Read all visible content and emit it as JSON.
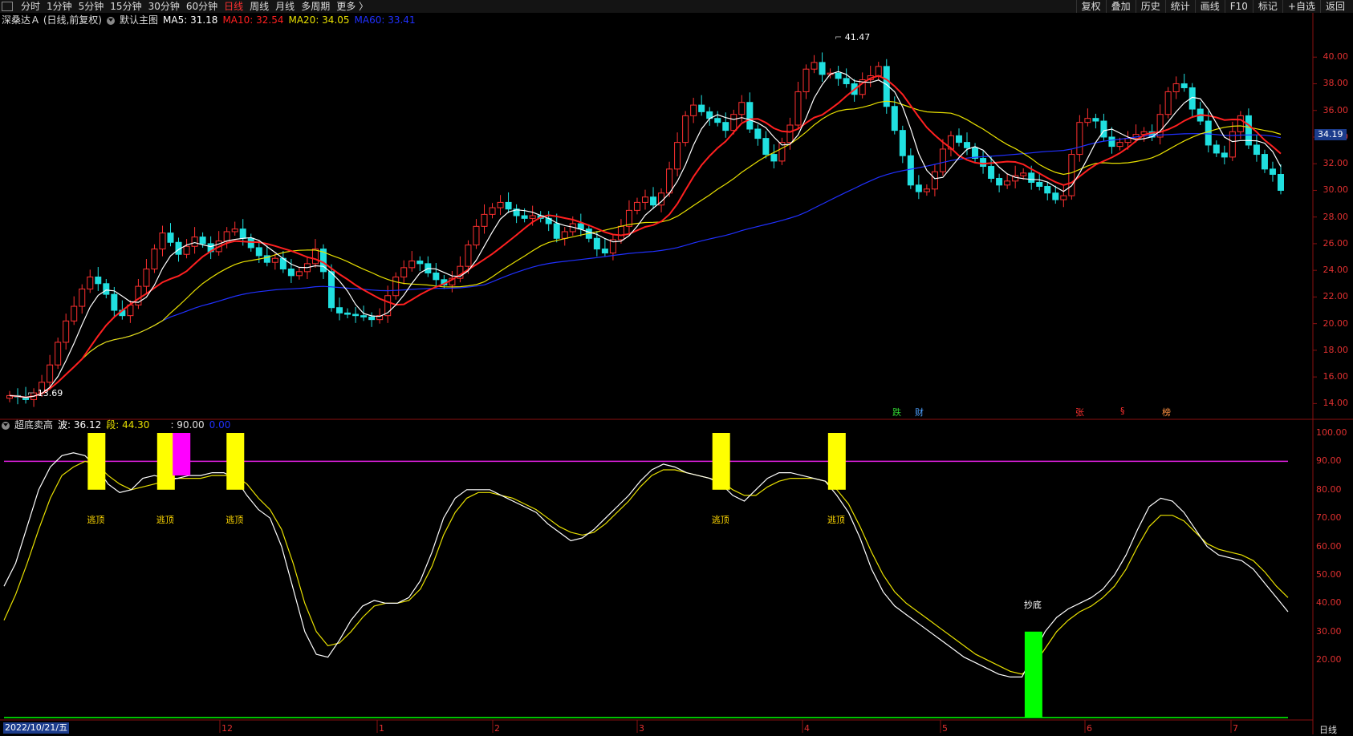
{
  "toolbar": {
    "periods": [
      "分时",
      "1分钟",
      "5分钟",
      "15分钟",
      "30分钟",
      "60分钟",
      "日线",
      "周线",
      "月线",
      "多周期",
      "更多 〉"
    ],
    "active_period": "日线",
    "actions": [
      "复权",
      "叠加",
      "历史",
      "统计",
      "画线",
      "F10",
      "标记",
      "+自选",
      "返回"
    ]
  },
  "main_info": {
    "stock": "深桑达Ａ (日线,前复权)",
    "template": "默认主图",
    "ma5": "MA5: 31.18",
    "ma10": "MA10: 32.54",
    "ma20": "MA20: 34.05",
    "ma60": "MA60: 33.41"
  },
  "ind_info": {
    "name": "超底卖高",
    "bo": "波: 36.12",
    "duan": "段: 44.30",
    "line": ": 90.00",
    "zero": "0.00"
  },
  "price_axis": [
    "40.00",
    "38.00",
    "36.00",
    "34.00",
    "32.00",
    "30.00",
    "28.00",
    "26.00",
    "24.00",
    "22.00",
    "20.00",
    "18.00",
    "16.00",
    "14.00"
  ],
  "ind_axis": [
    "100.00",
    "90.00",
    "80.00",
    "70.00",
    "60.00",
    "50.00",
    "40.00",
    "30.00",
    "20.00"
  ],
  "high_label": "41.47",
  "low_label": "13.69",
  "current_price": "34.19",
  "signals": [
    "逃顶",
    "逃顶",
    "逃顶",
    "逃顶",
    "逃顶"
  ],
  "bottom_signal": "抄底",
  "events": [
    {
      "text": "跌",
      "color": "#30d030"
    },
    {
      "text": "财",
      "color": "#4da0ff"
    },
    {
      "text": "张",
      "color": "#ff3030"
    },
    {
      "text": "§",
      "color": "#ff3030"
    },
    {
      "text": "榜",
      "color": "#ff9040"
    }
  ],
  "date_start": "2022/10/21/五",
  "month_labels": [
    "12",
    "1",
    "2",
    "3",
    "4",
    "5",
    "6",
    "7"
  ],
  "period_tag": "日线",
  "colors": {
    "up": "#ff3030",
    "down": "#20e0e0",
    "ma5": "#ffffff",
    "ma10": "#ff2020",
    "ma20": "#e8e000",
    "ma60": "#2030ff",
    "line90": "#e020e0",
    "zero": "#00c000"
  },
  "chart_data": {
    "type": "line",
    "price_range": [
      13,
      42
    ],
    "indicator_range": [
      0,
      100
    ],
    "close": [
      14.6,
      14.5,
      14.3,
      14.8,
      15.6,
      16.9,
      18.6,
      20.2,
      21.3,
      22.6,
      23.5,
      23.0,
      22.2,
      21.0,
      20.6,
      21.4,
      22.8,
      24.1,
      25.6,
      26.8,
      26.1,
      25.2,
      25.8,
      26.5,
      26.0,
      25.4,
      26.2,
      26.9,
      27.1,
      26.4,
      25.7,
      25.1,
      24.6,
      24.9,
      24.1,
      23.6,
      23.9,
      24.5,
      25.6,
      23.9,
      21.2,
      20.8,
      20.7,
      20.6,
      20.5,
      20.3,
      20.6,
      22.1,
      23.5,
      24.2,
      24.7,
      24.5,
      23.8,
      23.3,
      22.9,
      23.4,
      24.3,
      25.9,
      27.3,
      28.2,
      28.7,
      29.1,
      28.6,
      28.1,
      27.9,
      28.1,
      27.9,
      27.5,
      26.4,
      26.9,
      27.5,
      27.1,
      26.4,
      25.6,
      25.3,
      26.3,
      27.3,
      28.5,
      29.1,
      29.5,
      28.9,
      29.8,
      31.6,
      33.6,
      35.6,
      36.4,
      35.9,
      35.4,
      35.1,
      34.5,
      35.7,
      36.6,
      34.6,
      33.9,
      32.7,
      32.2,
      33.6,
      34.9,
      37.4,
      39.1,
      39.6,
      38.7,
      38.8,
      38.4,
      38.0,
      37.2,
      38.3,
      38.6,
      39.3,
      36.3,
      34.5,
      32.6,
      30.4,
      29.9,
      30.1,
      31.4,
      33.1,
      34.1,
      33.6,
      33.2,
      32.4,
      31.8,
      30.9,
      30.4,
      30.7,
      31.1,
      31.3,
      30.6,
      30.3,
      29.8,
      29.3,
      29.6,
      32.7,
      35.1,
      35.4,
      35.2,
      34.0,
      33.3,
      33.6,
      33.9,
      34.2,
      34.4,
      34.0,
      35.7,
      37.4,
      38.0,
      37.7,
      36.1,
      35.2,
      33.4,
      32.8,
      32.5,
      34.4,
      35.6,
      33.4,
      32.7,
      31.6,
      31.2,
      30.0
    ],
    "ind_bo": [
      46,
      54,
      67,
      80,
      88,
      92,
      93,
      92,
      88,
      82,
      79,
      80,
      84,
      85,
      84,
      84,
      85,
      85,
      86,
      86,
      84,
      78,
      73,
      70,
      60,
      45,
      30,
      22,
      21,
      27,
      34,
      39,
      41,
      40,
      40,
      42,
      48,
      58,
      70,
      77,
      80,
      80,
      80,
      78,
      76,
      74,
      72,
      68,
      65,
      62,
      63,
      66,
      70,
      74,
      78,
      83,
      87,
      89,
      88,
      86,
      85,
      84,
      82,
      78,
      76,
      80,
      84,
      86,
      86,
      85,
      84,
      83,
      78,
      72,
      63,
      52,
      44,
      39,
      36,
      33,
      30,
      27,
      24,
      21,
      19,
      17,
      15,
      14,
      14,
      22,
      30,
      35,
      38,
      40,
      42,
      45,
      50,
      57,
      66,
      74,
      77,
      76,
      72,
      66,
      60,
      57,
      56,
      55,
      52,
      47,
      42,
      37
    ],
    "ind_duan": [
      34,
      43,
      54,
      66,
      77,
      85,
      88,
      90,
      89,
      85,
      82,
      80,
      81,
      82,
      83,
      84,
      84,
      84,
      85,
      85,
      85,
      82,
      77,
      73,
      66,
      54,
      40,
      30,
      25,
      26,
      30,
      35,
      39,
      40,
      40,
      41,
      45,
      53,
      64,
      72,
      77,
      79,
      79,
      78,
      77,
      75,
      73,
      70,
      67,
      65,
      64,
      65,
      68,
      72,
      76,
      81,
      85,
      87,
      87,
      86,
      85,
      84,
      83,
      80,
      78,
      78,
      81,
      83,
      84,
      84,
      84,
      83,
      80,
      75,
      67,
      58,
      50,
      44,
      40,
      37,
      34,
      31,
      28,
      25,
      22,
      20,
      18,
      16,
      15,
      18,
      24,
      30,
      34,
      37,
      39,
      42,
      46,
      52,
      60,
      67,
      71,
      71,
      69,
      65,
      61,
      59,
      58,
      57,
      55,
      51,
      46,
      42
    ],
    "escape_top_signals": [
      8,
      14,
      20,
      62,
      72
    ],
    "bottom_signal_index": 89,
    "magenta_bar_index": 15
  }
}
